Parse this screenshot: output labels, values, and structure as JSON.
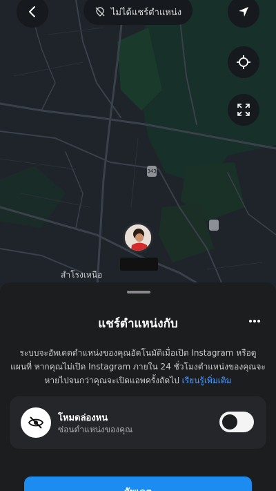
{
  "map": {
    "status_pill": {
      "label": "ไม่ได้แชร์ตำแหน่ง",
      "icon": "location-off-icon"
    },
    "buttons": {
      "back": {
        "icon": "chevron-left-icon"
      },
      "navigate": {
        "icon": "navigation-arrow-icon"
      },
      "recenter": {
        "icon": "locate-icon"
      },
      "fullscreen": {
        "icon": "expand-icon"
      }
    },
    "place_label": "สำโรงเหนือ",
    "badges": [
      "343",
      ""
    ],
    "colors": {
      "map_bg": "#1f242b",
      "park": "#18332a",
      "road": "#3a414a"
    }
  },
  "sheet": {
    "title": "แชร์ตำแหน่งกับ",
    "more_icon": "more-horizontal-icon",
    "description": "ระบบจะอัพเดตตำแหน่งของคุณอัตโนมัติเมื่อเปิด Instagram หรือดูแผนที่ หากคุณไม่เปิด Instagram ภายใน 24 ชั่วโมงตำแหน่งของคุณจะหายไปจนกว่าคุณจะเปิดแอพครั้งถัดไป",
    "learn_more": "เรียนรู้เพิ่มเติม",
    "ghost_mode": {
      "title": "โหมดล่องหน",
      "subtitle": "ซ่อนตำแหน่งของคุณ",
      "icon": "eye-off-icon",
      "enabled": true
    },
    "share_button": "อัพเดต",
    "colors": {
      "accent": "#1d8cf0",
      "link": "#4c9bff",
      "sheet_bg": "#1c1d1f"
    }
  }
}
